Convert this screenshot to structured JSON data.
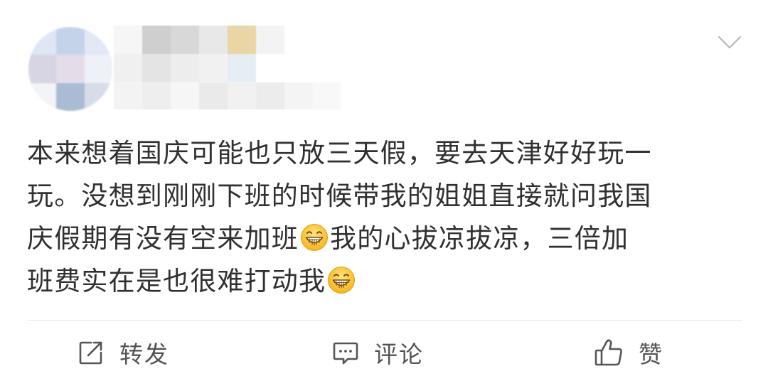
{
  "post": {
    "lines": [
      "本来想着国庆可能也只放三天假，要去天津好好玩一",
      "玩。没想到刚刚下班的时候带我的姐姐直接就问我国",
      "庆假期有没有空来加班",
      "我的心拔凉拔凉，三倍加",
      "班费实在是也很难打动我"
    ],
    "emoji": "grinning-face-emoji"
  },
  "actions": {
    "repost_label": "转发",
    "comment_label": "评论",
    "like_label": "赞"
  },
  "colors": {
    "text": "#303030",
    "action_text": "#555555",
    "icon": "#555555",
    "divider": "#e9e9e9"
  },
  "icons": {
    "menu": "chevron-down-icon",
    "repost": "repost-icon",
    "comment": "comment-icon",
    "like": "thumbs-up-icon"
  }
}
